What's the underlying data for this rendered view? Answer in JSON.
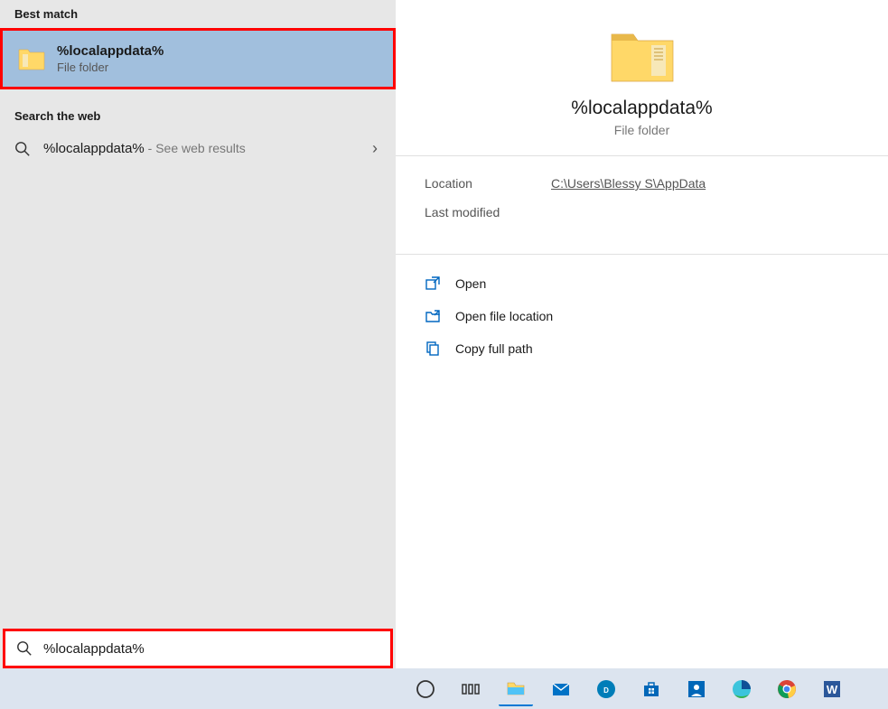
{
  "left": {
    "best_match_header": "Best match",
    "best_match": {
      "title": "%localappdata%",
      "subtitle": "File folder"
    },
    "search_web_header": "Search the web",
    "web_result": {
      "query": "%localappdata%",
      "hint": " - See web results"
    }
  },
  "preview": {
    "title": "%localappdata%",
    "subtitle": "File folder",
    "location_label": "Location",
    "location_value": "C:\\Users\\Blessy S\\AppData",
    "modified_label": "Last modified",
    "actions": {
      "open": "Open",
      "open_location": "Open file location",
      "copy_path": "Copy full path"
    }
  },
  "search": {
    "value": "%localappdata%"
  },
  "taskbar": {
    "cortana": "Cortana",
    "taskview": "Task View",
    "explorer": "File Explorer",
    "mail": "Mail",
    "dell": "Dell",
    "store": "Microsoft Store",
    "dell2": "Dell App",
    "edge": "Microsoft Edge",
    "chrome": "Google Chrome",
    "word": "Microsoft Word"
  }
}
